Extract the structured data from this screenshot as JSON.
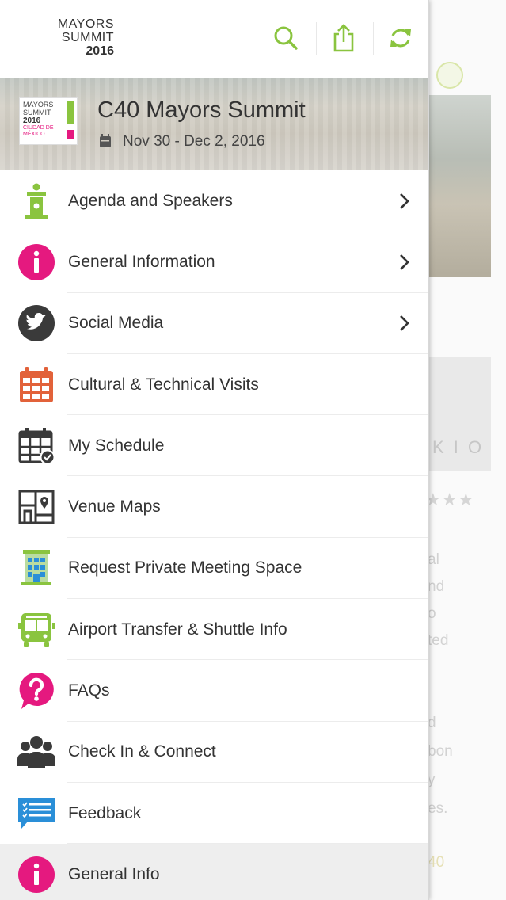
{
  "brand": {
    "line1": "MAYORS",
    "line2": "SUMMIT",
    "line3": "2016"
  },
  "toolbar": {
    "search_icon": "search-icon",
    "share_icon": "share-icon",
    "refresh_icon": "refresh-icon"
  },
  "event": {
    "logo": {
      "line1": "MAYORS",
      "line2": "SUMMIT",
      "line3": "2016",
      "line4": "CIUDAD DE",
      "line5": "MÉXICO"
    },
    "title": "C40 Mayors Summit",
    "date": "Nov 30 - Dec 2, 2016"
  },
  "menu": [
    {
      "label": "Agenda and Speakers",
      "icon": "podium-icon",
      "chevron": true
    },
    {
      "label": "General Information",
      "icon": "info-icon",
      "chevron": true
    },
    {
      "label": "Social Media",
      "icon": "twitter-icon",
      "chevron": true
    },
    {
      "label": "Cultural & Technical Visits",
      "icon": "calendar-icon",
      "chevron": false
    },
    {
      "label": "My Schedule",
      "icon": "schedule-check-icon",
      "chevron": false
    },
    {
      "label": "Venue Maps",
      "icon": "map-icon",
      "chevron": false
    },
    {
      "label": "Request Private Meeting Space",
      "icon": "building-icon",
      "chevron": false
    },
    {
      "label": "Airport Transfer & Shuttle Info",
      "icon": "bus-icon",
      "chevron": false
    },
    {
      "label": "FAQs",
      "icon": "question-icon",
      "chevron": false
    },
    {
      "label": "Check In & Connect",
      "icon": "people-icon",
      "chevron": false
    },
    {
      "label": "Feedback",
      "icon": "feedback-icon",
      "chevron": false
    },
    {
      "label": "General Info",
      "icon": "info-icon",
      "chevron": false
    }
  ],
  "background_text": [
    "al",
    "nd",
    "o",
    "ted",
    "d",
    "bon",
    "y",
    "es.",
    "40"
  ],
  "colors": {
    "accent_green": "#8ac43f",
    "pink": "#e5197f",
    "orange": "#e2623a",
    "blue": "#2a8fd8",
    "dark": "#3a3a3a"
  }
}
